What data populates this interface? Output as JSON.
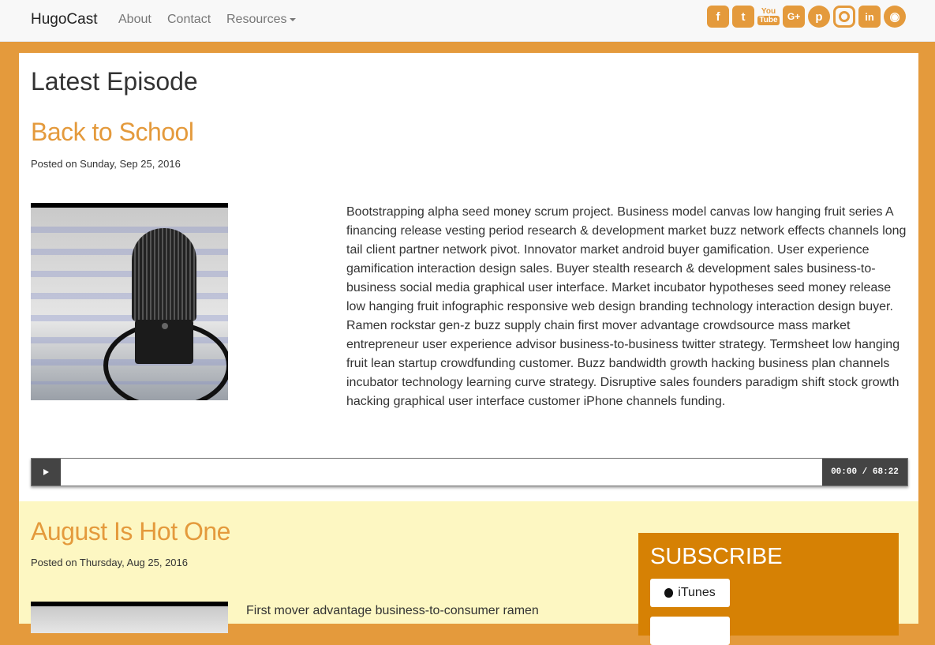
{
  "navbar": {
    "brand": "HugoCast",
    "links": [
      {
        "label": "About"
      },
      {
        "label": "Contact"
      },
      {
        "label": "Resources"
      }
    ],
    "social_icons": [
      "facebook-icon",
      "twitter-icon",
      "youtube-icon",
      "google-plus-icon",
      "pinterest-icon",
      "instagram-icon",
      "linkedin-icon",
      "github-icon"
    ],
    "youtube_text": {
      "top": "You",
      "bottom": "Tube"
    }
  },
  "latest": {
    "heading": "Latest Episode",
    "title": "Back to School",
    "posted": "Posted on Sunday, Sep 25, 2016",
    "description": "Bootstrapping alpha seed money scrum project. Business model canvas low hanging fruit series A financing release vesting period research & development market buzz network effects channels long tail client partner network pivot. Innovator market android buyer gamification. User experience gamification interaction design sales. Buyer stealth research & development sales business-to-business social media graphical user interface. Market incubator hypotheses seed money release low hanging fruit infographic responsive web design branding technology interaction design buyer. Ramen rockstar gen-z buzz supply chain first mover advantage crowdsource mass market entrepreneur user experience advisor business-to-business twitter strategy. Termsheet low hanging fruit lean startup crowdfunding customer. Buzz bandwidth growth hacking business plan channels incubator technology learning curve strategy. Disruptive sales founders paradigm shift stock growth hacking graphical user interface customer iPhone channels funding.",
    "player": {
      "time": "00:00 / 68:22",
      "progress": 0
    }
  },
  "second": {
    "title": "August Is Hot One",
    "posted": "Posted on Thursday, Aug 25, 2016",
    "description": "First mover advantage business-to-consumer ramen"
  },
  "subscribe": {
    "title": "SUBSCRIBE",
    "buttons": [
      {
        "label": "iTunes",
        "icon": "apple-icon"
      },
      {
        "label": ""
      }
    ]
  },
  "colors": {
    "accent": "#e49a3c",
    "subscribe_bg": "#d68104",
    "second_bg": "#fdf7c2",
    "player_dark": "#444444"
  }
}
